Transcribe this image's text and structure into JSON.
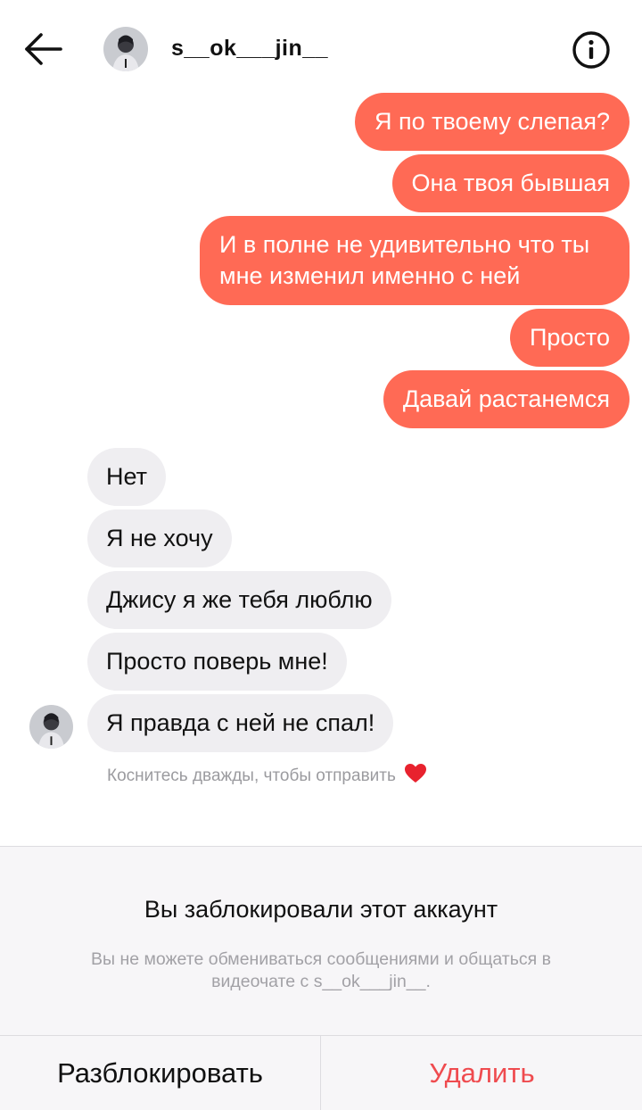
{
  "header": {
    "username": "s__ok___jin__",
    "back_icon": "arrow-left-icon",
    "info_icon": "info-circle-icon"
  },
  "messages_sent": [
    {
      "text": "Я по твоему слепая?"
    },
    {
      "text": "Она твоя бывшая"
    },
    {
      "line1": "И в полне не удивительно что ты",
      "line2": "мне изменил именно с ней"
    },
    {
      "text": "Просто"
    },
    {
      "text": "Давай растанемся"
    }
  ],
  "messages_received": [
    {
      "text": "Нет"
    },
    {
      "text": "Я не хочу"
    },
    {
      "text": "Джису я же тебя люблю"
    },
    {
      "text": "Просто поверь мне!"
    },
    {
      "text": "Я правда с ней не спал!"
    }
  ],
  "hint": {
    "text": "Коснитесь дважды, чтобы отправить",
    "icon": "heart-icon"
  },
  "blocked": {
    "title": "Вы заблокировали этот аккаунт",
    "desc_line1": "Вы не можете обмениваться сообщениями и общаться в",
    "desc_line2": "видеочате с s__ok___jin__."
  },
  "actions": {
    "unblock_label": "Разблокировать",
    "delete_label": "Удалить"
  },
  "colors": {
    "sent_bubble": "#ff6a55",
    "received_bubble": "#efeef1",
    "delete_red": "#ef4b4f",
    "panel_bg": "#f7f6f8"
  }
}
